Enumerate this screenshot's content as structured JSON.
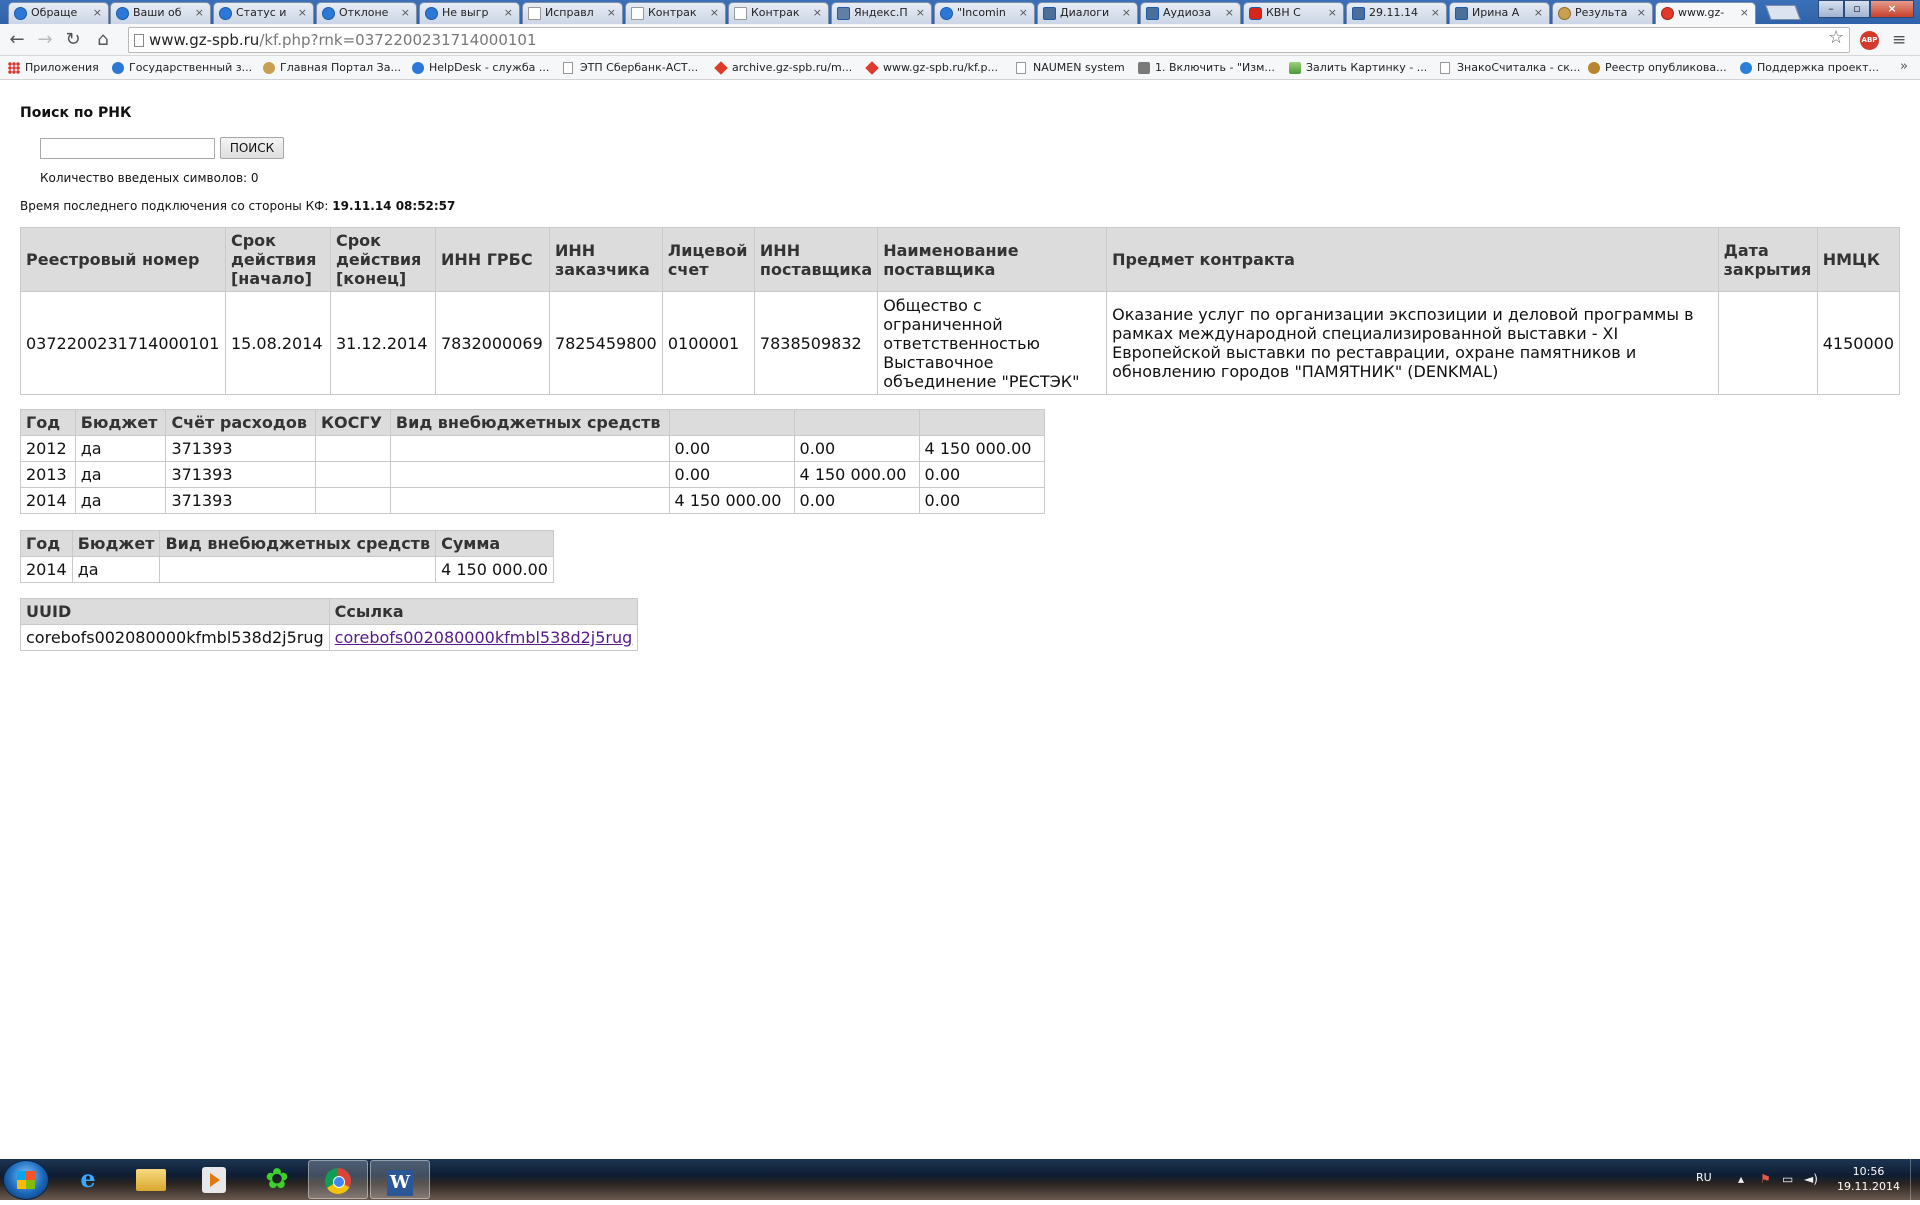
{
  "browser": {
    "tabs": [
      {
        "label": "Обраще",
        "icon": "globe"
      },
      {
        "label": "Ваши об",
        "icon": "globe"
      },
      {
        "label": "Статус и",
        "icon": "globe"
      },
      {
        "label": "Отклоне",
        "icon": "globe"
      },
      {
        "label": "Не выгр",
        "icon": "globe"
      },
      {
        "label": "Исправл",
        "icon": "doc"
      },
      {
        "label": "Контрак",
        "icon": "doc"
      },
      {
        "label": "Контрак",
        "icon": "doc"
      },
      {
        "label": "Яндекс.П",
        "icon": "mail"
      },
      {
        "label": "\"Incomin",
        "icon": "globe"
      },
      {
        "label": "Диалоги",
        "icon": "vk"
      },
      {
        "label": "Аудиоза",
        "icon": "vk"
      },
      {
        "label": "КВН С",
        "icon": "yt"
      },
      {
        "label": "29.11.14",
        "icon": "vk"
      },
      {
        "label": "Ирина А",
        "icon": "vk"
      },
      {
        "label": "Результа",
        "icon": "seal"
      },
      {
        "label": "www.gz-",
        "icon": "star",
        "active": true
      }
    ],
    "address": {
      "host": "www.gz-spb.ru",
      "path": "/kf.php?rnk=0372200231714000101"
    },
    "bookmarks": [
      {
        "label": "Приложения",
        "icon": "apps"
      },
      {
        "label": "Государственный з...",
        "icon": "globe"
      },
      {
        "label": "Главная Портал За...",
        "icon": "seal"
      },
      {
        "label": "HelpDesk - служба ...",
        "icon": "globe"
      },
      {
        "label": "ЭТП Сбербанк-АСТ...",
        "icon": "doc"
      },
      {
        "label": "archive.gz-spb.ru/m...",
        "icon": "star"
      },
      {
        "label": "www.gz-spb.ru/kf.p...",
        "icon": "star"
      },
      {
        "label": "NAUMEN system",
        "icon": "doc"
      },
      {
        "label": "1. Включить - \"Изм...",
        "icon": "user"
      },
      {
        "label": "Залить Картинку - ...",
        "icon": "img"
      },
      {
        "label": "ЗнакоСчиталка - ск...",
        "icon": "doc"
      },
      {
        "label": "Реестр опубликова...",
        "icon": "eagle"
      },
      {
        "label": "Поддержка проект...",
        "icon": "ie"
      }
    ],
    "more_bookmarks": "»"
  },
  "search": {
    "title": "Поиск по РНК",
    "input_value": "",
    "button_label": "ПОИСК",
    "char_count_text": "Количество введеных символов: 0"
  },
  "last_connection": {
    "label": "Время последнего подключения со стороны КФ:",
    "value": "19.11.14 08:52:57"
  },
  "main_table": {
    "headers": [
      "Реестровый номер",
      "Срок действия [начало]",
      "Срок действия [конец]",
      "ИНН ГРБС",
      "ИНН заказчика",
      "Лицевой счет",
      "ИНН поставщика",
      "Наименование поставщика",
      "Предмет контракта",
      "Дата закрытия",
      "НМЦК"
    ],
    "row": [
      "0372200231714000101",
      "15.08.2014",
      "31.12.2014",
      "7832000069",
      "7825459800",
      "0100001",
      "7838509832",
      "Общество с ограниченной ответственностью Выставочное объединение \"РЕСТЭК\"",
      "Оказание услуг по организации экспозиции и деловой программы в рамках международной специализированной выставки - XI Европейской выставки по реставрации, охране памятников и обновлению городов \"ПАМЯТНИК\" (DENKMAL)",
      "",
      "4150000"
    ]
  },
  "budget_table": {
    "headers": [
      "Год",
      "Бюджет",
      "Счёт расходов",
      "КОСГУ",
      "Вид внебюджетных средств",
      "",
      "",
      ""
    ],
    "rows": [
      [
        " 2012",
        "да",
        "  371393",
        "",
        "",
        " 0.00",
        " 0.00",
        " 4 150 000.00"
      ],
      [
        " 2013",
        "да",
        "  371393",
        "",
        "",
        " 0.00",
        " 4 150 000.00",
        " 0.00"
      ],
      [
        " 2014",
        "да",
        "  371393",
        "",
        "",
        " 4 150 000.00",
        " 0.00",
        " 0.00"
      ]
    ]
  },
  "extra_table": {
    "headers": [
      "Год",
      "Бюджет",
      "Вид внебюджетных средств",
      "Сумма"
    ],
    "rows": [
      [
        "2014",
        "да",
        "",
        "4 150 000.00"
      ]
    ]
  },
  "uuid_table": {
    "headers": [
      "UUID",
      "Ссылка"
    ],
    "uuid": "corebofs002080000kfmbl538d2j5rug",
    "link": "corebofs002080000kfmbl538d2j5rug"
  },
  "taskbar": {
    "language": "RU",
    "time": "10:56",
    "date": "19.11.2014"
  }
}
